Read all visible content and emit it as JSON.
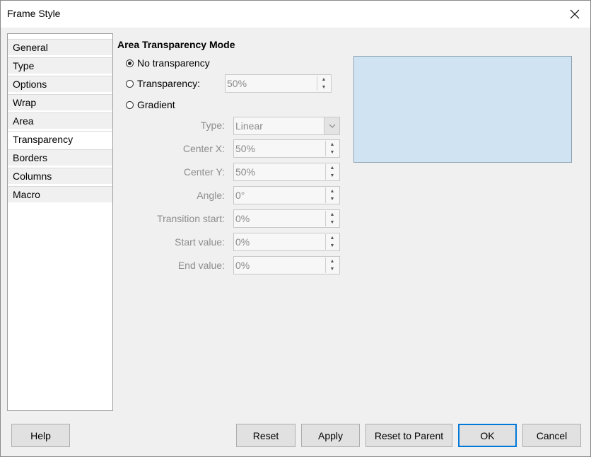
{
  "window": {
    "title": "Frame Style"
  },
  "nav": {
    "items": [
      {
        "label": "General"
      },
      {
        "label": "Type"
      },
      {
        "label": "Options"
      },
      {
        "label": "Wrap"
      },
      {
        "label": "Area"
      },
      {
        "label": "Transparency",
        "selected": true
      },
      {
        "label": "Borders"
      },
      {
        "label": "Columns"
      },
      {
        "label": "Macro"
      }
    ]
  },
  "transparency": {
    "section_title": "Area Transparency Mode",
    "modes": [
      {
        "label": "No transparency",
        "checked": true
      },
      {
        "label": "Transparency:",
        "checked": false
      },
      {
        "label": "Gradient",
        "checked": false
      }
    ],
    "transparency_value": "50%",
    "gradient": {
      "type_label": "Type:",
      "type_value": "Linear",
      "center_x_label": "Center X:",
      "center_x_value": "50%",
      "center_y_label": "Center Y:",
      "center_y_value": "50%",
      "angle_label": "Angle:",
      "angle_value": "0°",
      "transition_start_label": "Transition start:",
      "transition_start_value": "0%",
      "start_value_label": "Start value:",
      "start_value_value": "0%",
      "end_value_label": "End value:",
      "end_value_value": "0%"
    },
    "preview_color": "#cfe3f2"
  },
  "buttons": {
    "help": "Help",
    "reset": "Reset",
    "apply": "Apply",
    "reset_to_parent": "Reset to Parent",
    "ok": "OK",
    "cancel": "Cancel"
  },
  "colors": {
    "accent": "#0078d7"
  }
}
